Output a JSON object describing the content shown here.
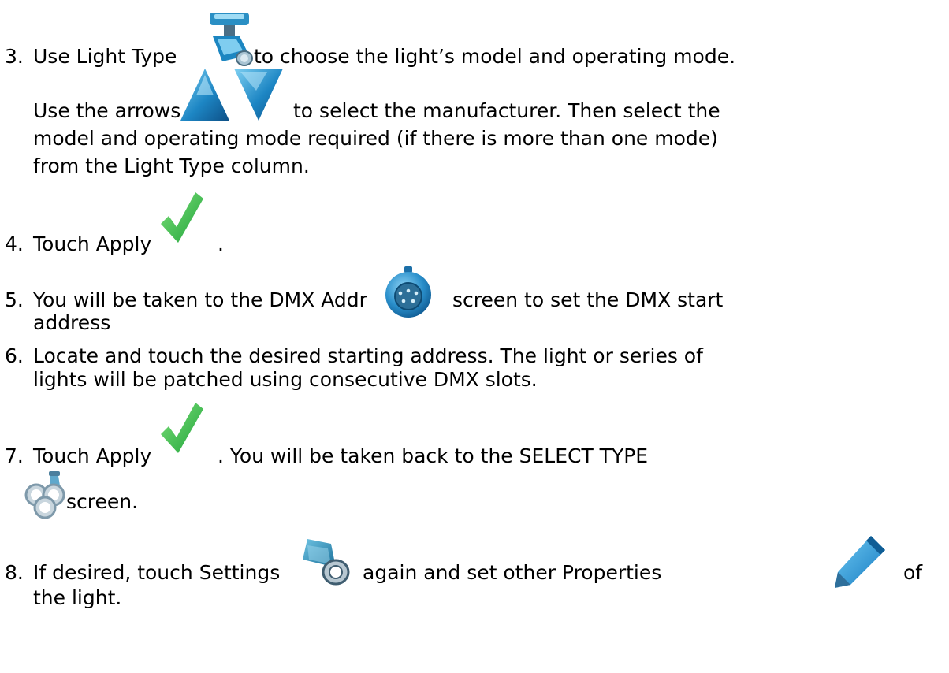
{
  "steps": [
    {
      "number": "3.",
      "line1_before": "Use Light Type",
      "line1_after": "to choose the light’s model and operating mode.",
      "line2_before": "Use the arrows",
      "line2_after": "to select the manufacturer.  Then select the",
      "line3": "model and operating mode required (if there is more than one mode)",
      "line4": "from the Light Type column.",
      "icons": [
        "moving-head-light-icon",
        "up-arrow-icon",
        "down-arrow-icon"
      ]
    },
    {
      "number": "4.",
      "line1_before": "Touch Apply",
      "line1_after": ".",
      "icons": [
        "apply-checkmark-icon"
      ]
    },
    {
      "number": "5.",
      "line1_before": "You will be taken to the DMX Addr",
      "line1_after": "screen to set the DMX start",
      "line2": "address",
      "icons": [
        "dmx-connector-icon"
      ]
    },
    {
      "number": "6.",
      "line1": "Locate and touch the desired starting address. The light or series of",
      "line2": "lights will be patched using consecutive DMX slots."
    },
    {
      "number": "7.",
      "line1_before": "Touch Apply",
      "line1_after": ". You will be taken back to the SELECT TYPE",
      "line2": "screen.",
      "icons": [
        "apply-checkmark-icon",
        "select-type-icon"
      ]
    },
    {
      "number": "8.",
      "line1_before": "If desired, touch Settings",
      "line1_mid": "again and set other Properties",
      "line1_after": "of",
      "line2": "the light.",
      "icons": [
        "settings-par-can-icon",
        "properties-pencil-icon"
      ]
    }
  ],
  "colors": {
    "text": "#000000",
    "checkmark": "#3dbf4a",
    "blue_icon": "#1f8fc8",
    "arrow": "#1a78b8"
  }
}
